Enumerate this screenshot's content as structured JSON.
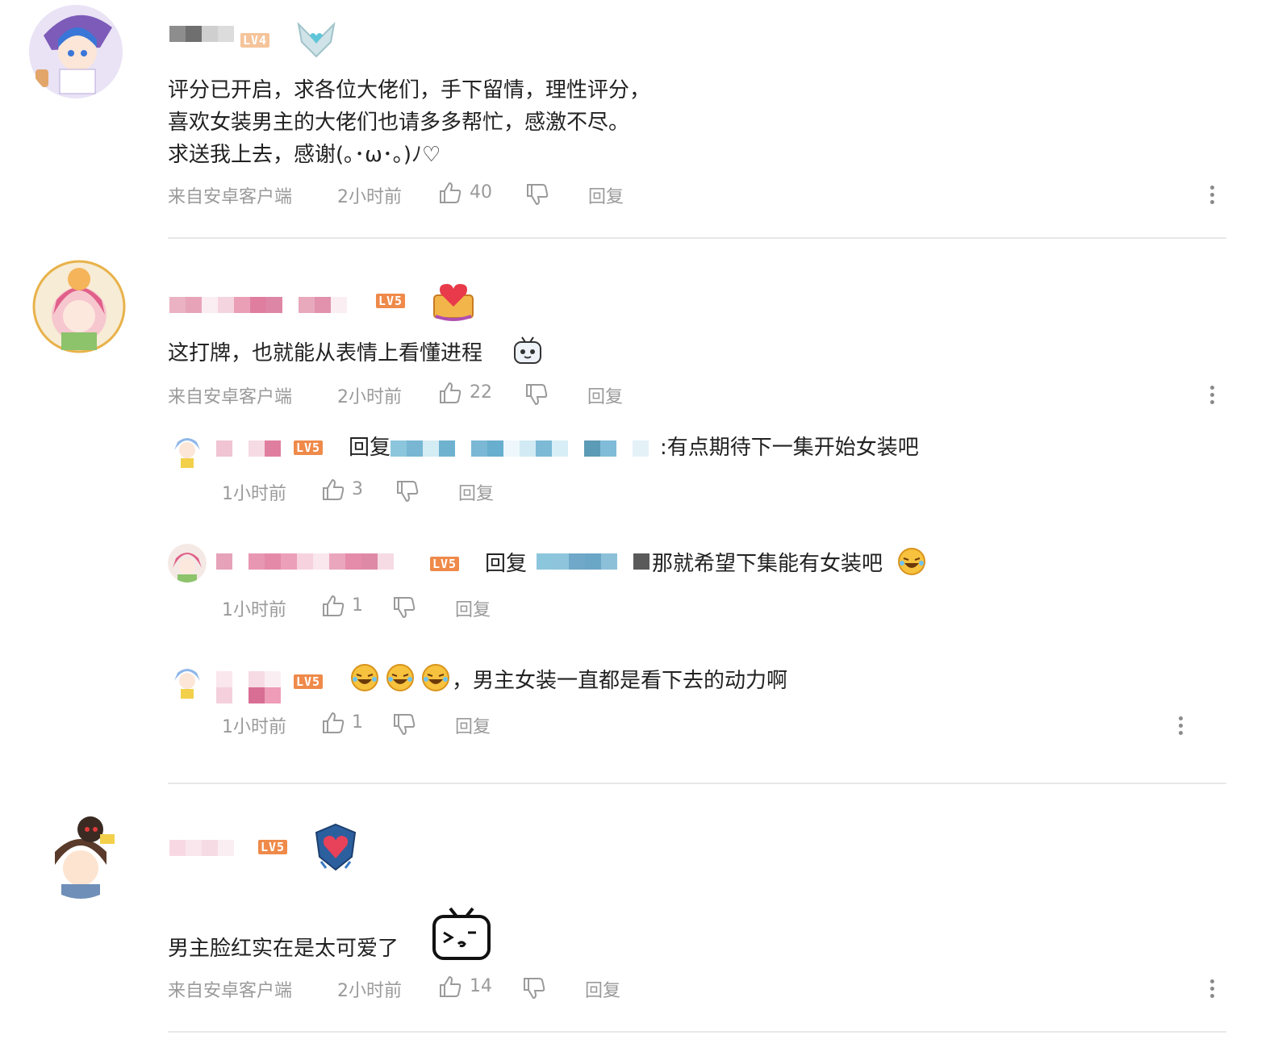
{
  "colors": {
    "text": "#222222",
    "meta": "#9a9a9a",
    "divider": "#e8e8e8",
    "level": "#ef8a4a"
  },
  "comments": [
    {
      "level_text": "LV4",
      "content_lines": [
        "评分已开启，求各位大佬们，手下留情，理性评分，",
        "喜欢女装男主的大佬们也请多多帮忙，感激不尽。",
        "求送我上去，感谢(｡･ω･｡)ﾉ♡"
      ],
      "source": "来自安卓客户端",
      "time": "2小时前",
      "likes": "40",
      "reply_label": "回复"
    },
    {
      "level_text": "LV5",
      "content": "这打牌，也就能从表情上看懂进程",
      "source": "来自安卓客户端",
      "time": "2小时前",
      "likes": "22",
      "reply_label": "回复",
      "replies": [
        {
          "level_text": "LV5",
          "reply_prefix": "回复",
          "text": ":有点期待下一集开始女装吧",
          "time": "1小时前",
          "likes": "3",
          "reply_label": "回复"
        },
        {
          "level_text": "LV5",
          "reply_prefix": "回复",
          "text": "那就希望下集能有女装吧",
          "time": "1小时前",
          "likes": "1",
          "reply_label": "回复"
        },
        {
          "level_text": "LV5",
          "text": "，男主女装一直都是看下去的动力啊",
          "time": "1小时前",
          "likes": "1",
          "reply_label": "回复"
        }
      ]
    },
    {
      "level_text": "LV5",
      "content": "男主脸红实在是太可爱了",
      "source": "来自安卓客户端",
      "time": "2小时前",
      "likes": "14",
      "reply_label": "回复"
    }
  ]
}
